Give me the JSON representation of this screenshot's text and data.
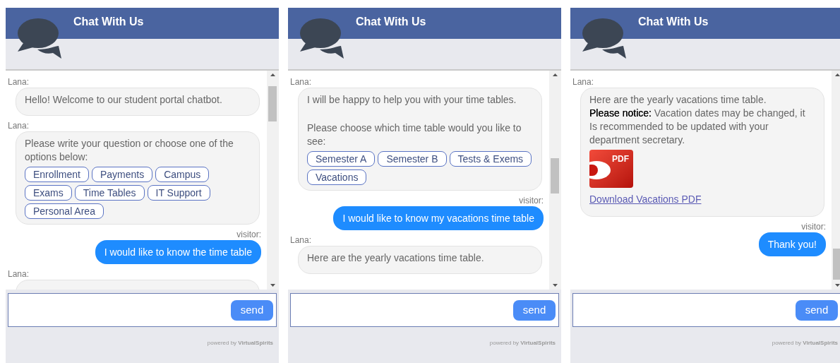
{
  "panels": [
    {
      "title": "Chat With Us",
      "messages": [
        {
          "kind": "bot",
          "sender": "Lana:",
          "paragraphs": [
            "Hello! Welcome to our student portal chatbot."
          ]
        },
        {
          "kind": "bot",
          "sender": "Lana:",
          "paragraphs": [
            "Please write your question or choose one of the options below:"
          ],
          "options": [
            "Enrollment",
            "Payments",
            "Campus",
            "Exams",
            "Time Tables",
            "IT Support",
            "Personal Area"
          ]
        },
        {
          "kind": "visitor",
          "sender": "visitor:",
          "paragraphs": [
            "I would like to know the time table"
          ]
        },
        {
          "kind": "bot",
          "sender": "Lana:"
        }
      ],
      "send": "send",
      "footer": "powered by **VirtualSpirits**"
    },
    {
      "title": "Chat With Us",
      "messages": [
        {
          "kind": "bot",
          "sender": "Lana:",
          "paragraphs": [
            "I will be happy to help you with your time tables.",
            "Please choose which time table would you like to see:"
          ],
          "options": [
            "Semester A",
            "Semester B",
            "Tests & Exems",
            "Vacations"
          ]
        },
        {
          "kind": "visitor",
          "sender": "visitor:",
          "paragraphs": [
            "I would like to know my vacations time table"
          ]
        },
        {
          "kind": "bot",
          "sender": "Lana:",
          "paragraphs": [
            "Here are the yearly vacations time table."
          ]
        }
      ],
      "send": "send",
      "footer": "powered by **VirtualSpirits**"
    },
    {
      "title": "Chat With Us",
      "messages": [
        {
          "kind": "bot",
          "sender": "Lana:",
          "paragraphs": [
            "Here are the yearly vacations time table.\n**Please notice:** Vacation dates may be changed, it Is recommended to be updated with your department secretary."
          ],
          "attachment": {
            "badge": "PDF",
            "link": "Download Vacations PDF"
          }
        },
        {
          "kind": "visitor",
          "sender": "visitor:",
          "paragraphs": [
            "Thank you!"
          ]
        }
      ],
      "send": "send",
      "footer": "powered by **VirtualSpirits**"
    }
  ]
}
